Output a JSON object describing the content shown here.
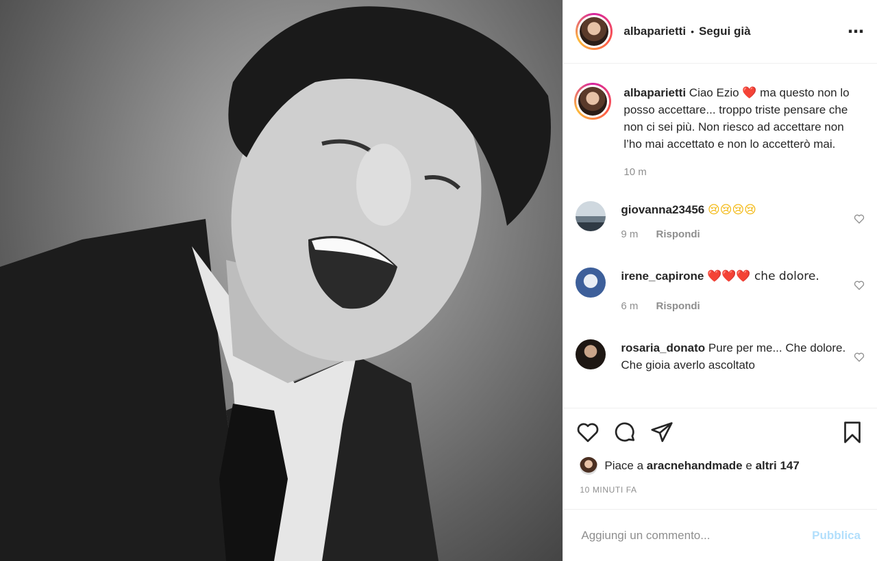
{
  "post": {
    "author": "albaparietti",
    "separator": "•",
    "follow_label": "Segui già",
    "more_icon": "⋯",
    "caption_author": "albaparietti",
    "caption_text": "Ciao Ezio ❤️ ma questo non lo posso accettare... troppo triste pensare che non ci sei più. Non riesco ad accettare non l’ho mai accettato e non lo accetterò mai.",
    "caption_time": "10 m"
  },
  "comments": [
    {
      "user": "giovanna23456",
      "text": "😢😢😢😢",
      "time": "9 m",
      "reply": "Rispondi"
    },
    {
      "user": "irene_capirone",
      "text": "❤️❤️❤️ che dolore.",
      "time": "6 m",
      "reply": "Rispondi"
    },
    {
      "user": "rosaria_donato",
      "text": "Pure per me... Che dolore. Che gioia averlo ascoltato"
    }
  ],
  "likes": {
    "prefix": "Piace a",
    "user": "aracnehandmade",
    "conj": "e",
    "others": "altri 147"
  },
  "time_ago": "10 MINUTI FA",
  "add_comment": {
    "placeholder": "Aggiungi un commento...",
    "post_label": "Pubblica"
  },
  "colors": {
    "accent_disabled": "#b2dffc",
    "muted": "#8e8e8e",
    "text": "#262626"
  }
}
